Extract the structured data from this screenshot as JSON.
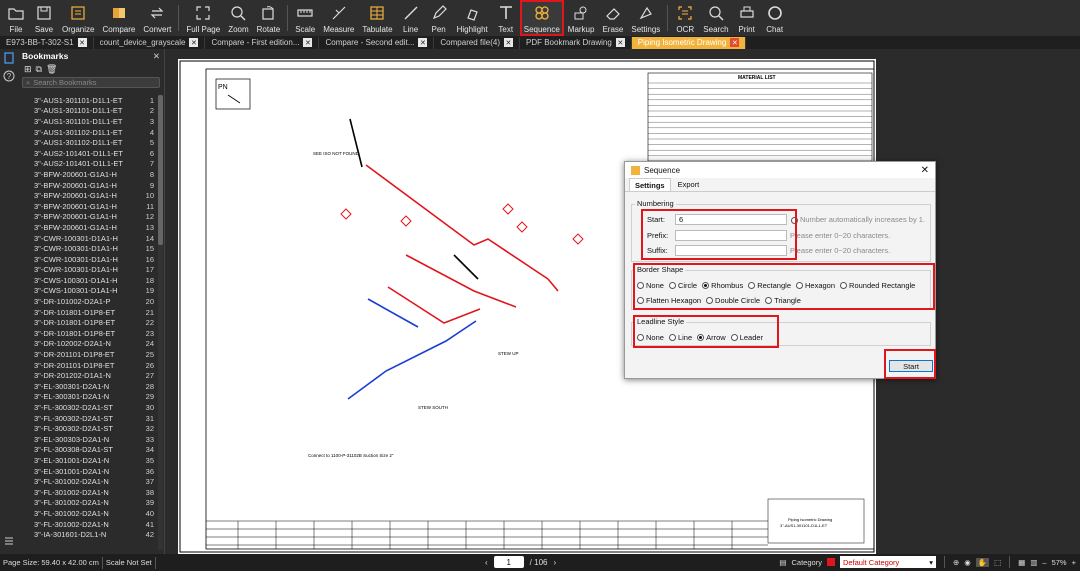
{
  "toolbar": {
    "items": [
      {
        "label": "File",
        "icon": "folder-icon"
      },
      {
        "label": "Save",
        "icon": "save-icon"
      },
      {
        "label": "Organize",
        "icon": "organize-icon"
      },
      {
        "label": "Compare",
        "icon": "compare-icon"
      },
      {
        "label": "Convert",
        "icon": "convert-icon"
      },
      {
        "label": "Full Page",
        "icon": "fullpage-icon"
      },
      {
        "label": "Zoom",
        "icon": "zoom-icon"
      },
      {
        "label": "Rotate",
        "icon": "rotate-icon"
      },
      {
        "label": "Scale",
        "icon": "scale-icon"
      },
      {
        "label": "Measure",
        "icon": "measure-icon"
      },
      {
        "label": "Tabulate",
        "icon": "tabulate-icon"
      },
      {
        "label": "Line",
        "icon": "line-icon"
      },
      {
        "label": "Pen",
        "icon": "pen-icon"
      },
      {
        "label": "Highlight",
        "icon": "highlight-icon"
      },
      {
        "label": "Text",
        "icon": "text-icon"
      },
      {
        "label": "Sequence",
        "icon": "sequence-icon"
      },
      {
        "label": "Markup",
        "icon": "markup-icon"
      },
      {
        "label": "Erase",
        "icon": "erase-icon"
      },
      {
        "label": "Settings",
        "icon": "settings-icon"
      },
      {
        "label": "OCR",
        "icon": "ocr-icon"
      },
      {
        "label": "Search",
        "icon": "search-icon"
      },
      {
        "label": "Print",
        "icon": "print-icon"
      },
      {
        "label": "Chat",
        "icon": "chat-icon"
      }
    ],
    "active": "Sequence"
  },
  "tabs": [
    {
      "label": "E973-BB-T-302-S1"
    },
    {
      "label": "count_device_grayscale"
    },
    {
      "label": "Compare - First edition..."
    },
    {
      "label": "Compare - Second edit..."
    },
    {
      "label": "Compared file(4)"
    },
    {
      "label": "PDF Bookmark Drawing"
    },
    {
      "label": "Piping Isometric Drawing",
      "active": true
    }
  ],
  "bookmarks": {
    "title": "Bookmarks",
    "search_placeholder": "Search Bookmarks",
    "items": [
      {
        "name": "3\"-AUS1-301101-D1L1-ET",
        "page": "1"
      },
      {
        "name": "3\"-AUS1-301101-D1L1-ET",
        "page": "2"
      },
      {
        "name": "3\"-AUS1-301101-D1L1-ET",
        "page": "3"
      },
      {
        "name": "3\"-AUS1-301102-D1L1-ET",
        "page": "4"
      },
      {
        "name": "3\"-AUS1-301102-D1L1-ET",
        "page": "5"
      },
      {
        "name": "3\"-AUS2-101401-D1L1-ET",
        "page": "6"
      },
      {
        "name": "3\"-AUS2-101401-D1L1-ET",
        "page": "7"
      },
      {
        "name": "3\"-BFW-200601-G1A1-H",
        "page": "8"
      },
      {
        "name": "3\"-BFW-200601-G1A1-H",
        "page": "9"
      },
      {
        "name": "3\"-BFW-200601-G1A1-H",
        "page": "10"
      },
      {
        "name": "3\"-BFW-200601-G1A1-H",
        "page": "11"
      },
      {
        "name": "3\"-BFW-200601-G1A1-H",
        "page": "12"
      },
      {
        "name": "3\"-BFW-200601-G1A1-H",
        "page": "13"
      },
      {
        "name": "3\"-CWR-100301-D1A1-H",
        "page": "14"
      },
      {
        "name": "3\"-CWR-100301-D1A1-H",
        "page": "15"
      },
      {
        "name": "3\"-CWR-100301-D1A1-H",
        "page": "16"
      },
      {
        "name": "3\"-CWR-100301-D1A1-H",
        "page": "17"
      },
      {
        "name": "3\"-CWS-100301-D1A1-H",
        "page": "18"
      },
      {
        "name": "3\"-CWS-100301-D1A1-H",
        "page": "19"
      },
      {
        "name": "3\"-DR-101002-D2A1-P",
        "page": "20"
      },
      {
        "name": "3\"-DR-101801-D1P8-ET",
        "page": "21"
      },
      {
        "name": "3\"-DR-101801-D1P8-ET",
        "page": "22"
      },
      {
        "name": "3\"-DR-101801-D1P8-ET",
        "page": "23"
      },
      {
        "name": "3\"-DR-102002-D2A1-N",
        "page": "24"
      },
      {
        "name": "3\"-DR-201101-D1P8-ET",
        "page": "25"
      },
      {
        "name": "3\"-DR-201101-D1P8-ET",
        "page": "26"
      },
      {
        "name": "3\"-DR-201202-D1A1-N",
        "page": "27"
      },
      {
        "name": "3\"-EL-300301-D2A1-N",
        "page": "28"
      },
      {
        "name": "3\"-EL-300301-D2A1-N",
        "page": "29"
      },
      {
        "name": "3\"-FL-300302-D2A1-ST",
        "page": "30"
      },
      {
        "name": "3\"-FL-300302-D2A1-ST",
        "page": "31"
      },
      {
        "name": "3\"-FL-300302-D2A1-ST",
        "page": "32"
      },
      {
        "name": "3\"-EL-300303-D2A1-N",
        "page": "33"
      },
      {
        "name": "3\"-FL-300308-D2A1-ST",
        "page": "34"
      },
      {
        "name": "3\"-EL-301001-D2A1-N",
        "page": "35"
      },
      {
        "name": "3\"-EL-301001-D2A1-N",
        "page": "36"
      },
      {
        "name": "3\"-FL-301002-D2A1-N",
        "page": "37"
      },
      {
        "name": "3\"-FL-301002-D2A1-N",
        "page": "38"
      },
      {
        "name": "3\"-FL-301002-D2A1-N",
        "page": "39"
      },
      {
        "name": "3\"-FL-301002-D2A1-N",
        "page": "40"
      },
      {
        "name": "3\"-FL-301002-D2A1-N",
        "page": "41"
      },
      {
        "name": "3\"-IA-301601-D2L1-N",
        "page": "42"
      }
    ]
  },
  "drawing": {
    "north_label": "PN",
    "material_list_title": "MATERIAL LIST",
    "title_block_name": "Piping Isometric Drawing",
    "title_block_line": "3\"-AUS1-301101-D1L1-ET",
    "callouts": [
      "SEE ISO NOT FOUND",
      "TEE ISO",
      "STEW SOUTH",
      "STEW UP",
      "Connect to 1100-P-31102B  Suction Size 2\""
    ]
  },
  "dialog": {
    "title": "Sequence",
    "tabs": [
      "Settings",
      "Export"
    ],
    "numbering_label": "Numbering",
    "start_label": "Start:",
    "start_value": "6",
    "auto_increase_hint": "Number automatically increases by 1.",
    "prefix_label": "Prefix:",
    "prefix_hint": "Please enter 0~20 characters.",
    "suffix_label": "Suffix:",
    "suffix_hint": "Please enter 0~20 characters.",
    "border_shape_label": "Border Shape",
    "border_shapes": [
      "None",
      "Circle",
      "Rhombus",
      "Rectangle",
      "Hexagon",
      "Rounded Rectangle",
      "Flatten Hexagon",
      "Double Circle",
      "Triangle"
    ],
    "border_selected": "Rhombus",
    "leadline_label": "Leadline Style",
    "leadline_styles": [
      "None",
      "Line",
      "Arrow",
      "Leader"
    ],
    "leadline_selected": "Arrow",
    "start_button": "Start"
  },
  "status": {
    "page_size": "Page Size: 59.40 x 42.00 cm",
    "scale": "Scale Not Set",
    "current_page": "1",
    "total_pages": "/ 106",
    "category_label": "Category",
    "category_value": "Default Category",
    "zoom": "57%"
  },
  "colors": {
    "accent_red": "#e0161c",
    "tab_active": "#f2b33d",
    "pipe_red": "#e0161c"
  }
}
